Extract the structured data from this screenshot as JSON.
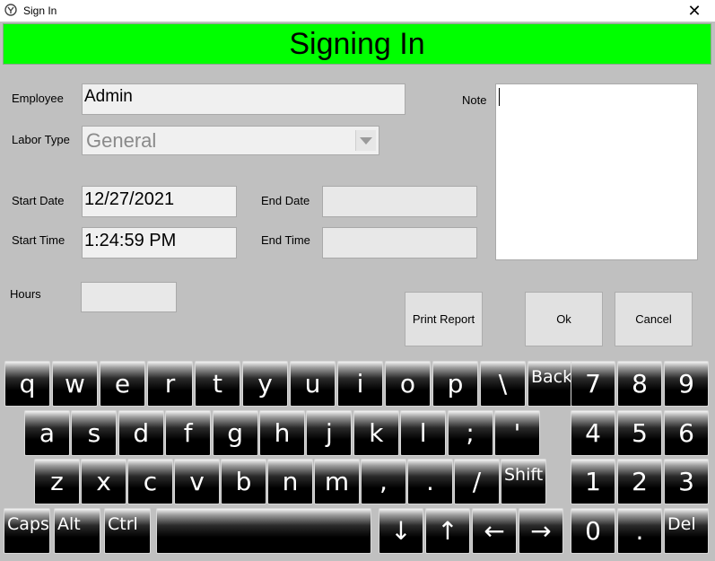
{
  "window": {
    "title": "Sign In",
    "close_glyph": "✕"
  },
  "banner": {
    "text": "Signing In",
    "color": "#00ff00"
  },
  "form": {
    "employee_label": "Employee",
    "employee_value": "Admin",
    "labor_type_label": "Labor Type",
    "labor_type_value": "General",
    "start_date_label": "Start Date",
    "start_date_value": "12/27/2021",
    "start_time_label": "Start Time",
    "start_time_value": "1:24:59 PM",
    "end_date_label": "End Date",
    "end_date_value": "",
    "end_time_label": "End Time",
    "end_time_value": "",
    "hours_label": "Hours",
    "hours_value": "",
    "note_label": "Note",
    "note_value": ""
  },
  "buttons": {
    "print_report": "Print Report",
    "ok": "Ok",
    "cancel": "Cancel"
  },
  "keyboard": {
    "row1": [
      "q",
      "w",
      "e",
      "r",
      "t",
      "y",
      "u",
      "i",
      "o",
      "p",
      "\\",
      "Back"
    ],
    "row2": [
      "a",
      "s",
      "d",
      "f",
      "g",
      "h",
      "j",
      "k",
      "l",
      ";",
      "'"
    ],
    "row3": [
      "z",
      "x",
      "c",
      "v",
      "b",
      "n",
      "m",
      ",",
      ".",
      "/",
      "Shift"
    ],
    "row4_mods": [
      "Caps",
      "Alt",
      "Ctrl"
    ],
    "space": "",
    "arrows": [
      "↓",
      "↑",
      "←",
      "→"
    ],
    "numpad": [
      "7",
      "8",
      "9",
      "4",
      "5",
      "6",
      "1",
      "2",
      "3",
      "0",
      ".",
      "Del"
    ]
  }
}
